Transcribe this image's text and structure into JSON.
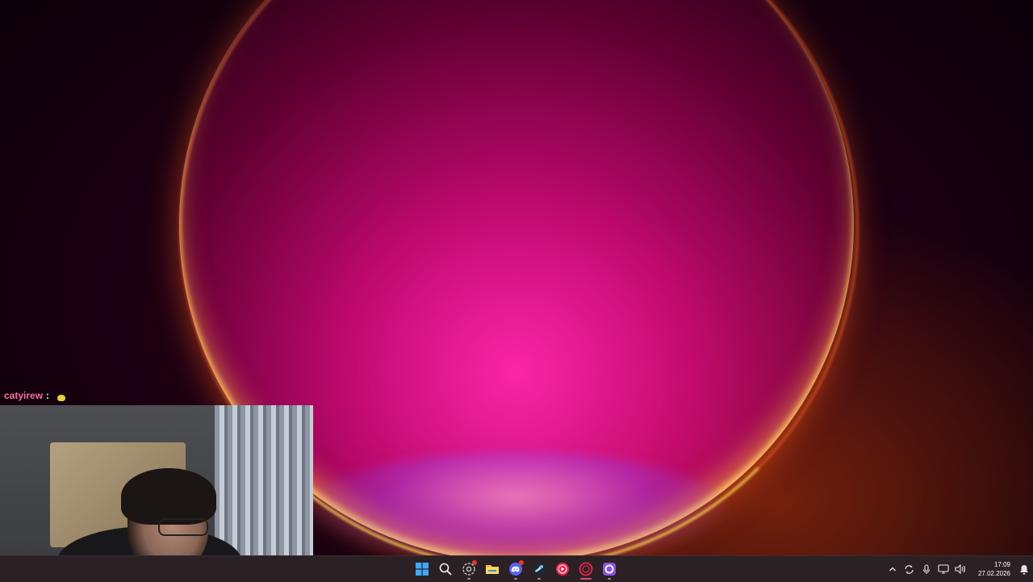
{
  "chat": {
    "username": "catyirew",
    "separator": ":"
  },
  "taskbar": {
    "apps": [
      {
        "name": "start-button",
        "icon": "windows-logo-icon"
      },
      {
        "name": "search-button",
        "icon": "search-icon"
      },
      {
        "name": "app-chrome-dev",
        "icon": "chrome-icon"
      },
      {
        "name": "app-file-explorer",
        "icon": "folder-icon"
      },
      {
        "name": "app-discord",
        "icon": "discord-icon"
      },
      {
        "name": "app-steam",
        "icon": "steam-icon"
      },
      {
        "name": "app-media-player",
        "icon": "play-icon"
      },
      {
        "name": "app-obs",
        "icon": "record-icon"
      },
      {
        "name": "app-twitch-client",
        "icon": "circle-app-icon"
      }
    ],
    "tray": {
      "time": "17:09",
      "date": "27.02.2026"
    }
  },
  "colors": {
    "taskbar_bg": "#2b2124",
    "chat_username": "#ff6fa8",
    "active_indicator": "#d94c7a",
    "orb_core": "#ff28aa",
    "orb_rim": "#ffd250"
  }
}
